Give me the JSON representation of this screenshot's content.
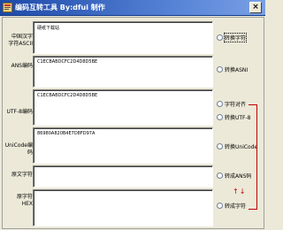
{
  "window": {
    "title": "编码互转工具  By:dfui 制作",
    "close_glyph": "×",
    "title_color": "#1c49a8"
  },
  "fields": [
    {
      "label": "中国汉字\n字符ASCII",
      "value": "硬纸下载站"
    },
    {
      "label": "ANS编码",
      "value": "C1ECBABDCFC2D4D8D5BE"
    },
    {
      "label": "UTF-8编码",
      "value": "C1ECBABDCFC2D4D8D5BE"
    },
    {
      "label": "UniCode编码",
      "value": "86980A820B4E7D8FD97A"
    },
    {
      "label": "原文字符",
      "value": ""
    },
    {
      "label": "原字符\nHEX",
      "value": ""
    }
  ],
  "options": [
    {
      "label": "转换字符",
      "focused": true
    },
    {
      "label": "转换ASNI",
      "focused": false
    },
    {
      "label": "字符对齐",
      "focused": false
    },
    {
      "label": "转换UTF-8",
      "focused": false
    },
    {
      "label": "转换UniCode",
      "focused": false
    },
    {
      "label": "转成ANS码",
      "focused": false
    },
    {
      "label": "转成字符",
      "focused": false
    }
  ],
  "arrow_glyphs": "↑↓",
  "accent_color": "#c00000"
}
